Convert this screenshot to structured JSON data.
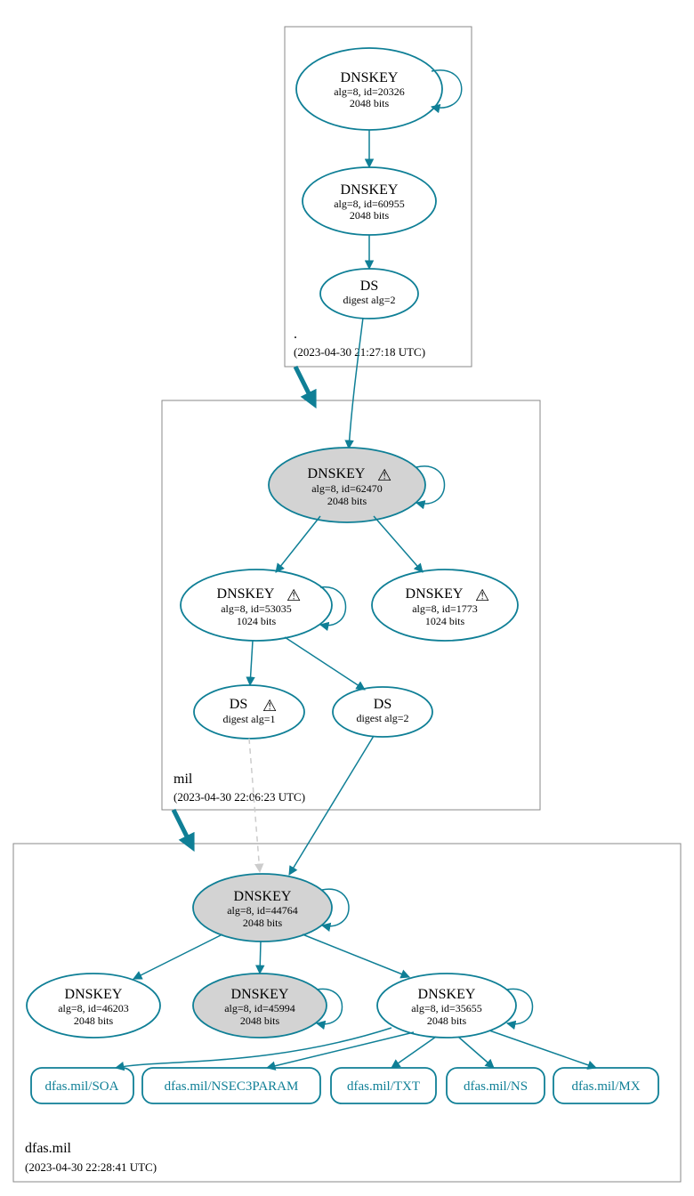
{
  "zones": {
    "root": {
      "name": ".",
      "timestamp": "(2023-04-30 21:27:18 UTC)"
    },
    "mil": {
      "name": "mil",
      "timestamp": "(2023-04-30 22:06:23 UTC)"
    },
    "dfas": {
      "name": "dfas.mil",
      "timestamp": "(2023-04-30 22:28:41 UTC)"
    }
  },
  "nodes": {
    "root_ksk": {
      "title": "DNSKEY",
      "l2": "alg=8, id=20326",
      "l3": "2048 bits",
      "warn": false
    },
    "root_zsk": {
      "title": "DNSKEY",
      "l2": "alg=8, id=60955",
      "l3": "2048 bits",
      "warn": false
    },
    "root_ds": {
      "title": "DS",
      "l2": "digest alg=2",
      "warn": false
    },
    "mil_ksk": {
      "title": "DNSKEY",
      "l2": "alg=8, id=62470",
      "l3": "2048 bits",
      "warn": true
    },
    "mil_zsk1": {
      "title": "DNSKEY",
      "l2": "alg=8, id=53035",
      "l3": "1024 bits",
      "warn": true
    },
    "mil_zsk2": {
      "title": "DNSKEY",
      "l2": "alg=8, id=1773",
      "l3": "1024 bits",
      "warn": true
    },
    "mil_ds1": {
      "title": "DS",
      "l2": "digest alg=1",
      "warn": true
    },
    "mil_ds2": {
      "title": "DS",
      "l2": "digest alg=2",
      "warn": false
    },
    "dfas_ksk": {
      "title": "DNSKEY",
      "l2": "alg=8, id=44764",
      "l3": "2048 bits",
      "warn": false
    },
    "dfas_k1": {
      "title": "DNSKEY",
      "l2": "alg=8, id=46203",
      "l3": "2048 bits",
      "warn": false
    },
    "dfas_k2": {
      "title": "DNSKEY",
      "l2": "alg=8, id=45994",
      "l3": "2048 bits",
      "warn": false
    },
    "dfas_k3": {
      "title": "DNSKEY",
      "l2": "alg=8, id=35655",
      "l3": "2048 bits",
      "warn": false
    }
  },
  "records": {
    "soa": "dfas.mil/SOA",
    "nsec3": "dfas.mil/NSEC3PARAM",
    "txt": "dfas.mil/TXT",
    "ns": "dfas.mil/NS",
    "mx": "dfas.mil/MX"
  },
  "icons": {
    "warn": "⚠"
  }
}
